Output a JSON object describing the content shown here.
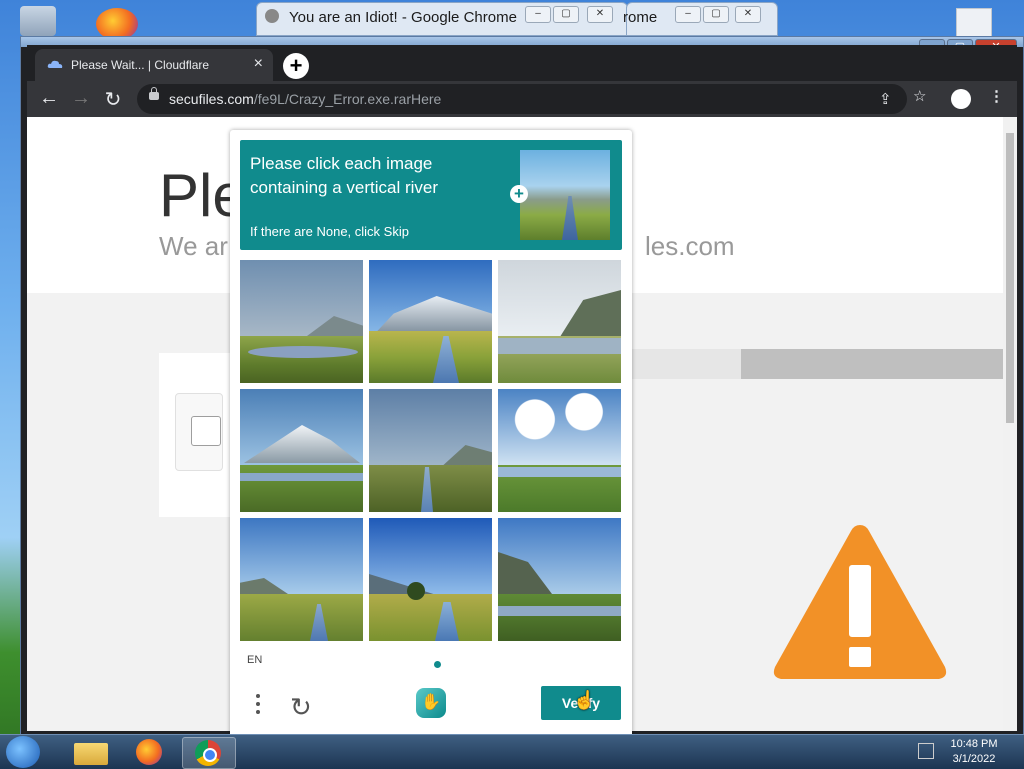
{
  "background_windows": [
    {
      "title": "You are an Idiot! - Google Chrome"
    },
    {
      "title": "rome"
    }
  ],
  "browser": {
    "tab_title": "Please Wait... | Cloudflare",
    "url_host": "secufiles.com",
    "url_path": "/fe9L/Crazy_Error.exe.rarHere"
  },
  "page": {
    "title_fragment": "Ple",
    "subtitle_fragment": "We ar",
    "subtitle_fragment_end": "les.com"
  },
  "captcha": {
    "prompt": "Please click each image containing a vertical river",
    "skip_hint": "If there are None, click Skip",
    "language": "EN",
    "verify_label": "Verify",
    "selected_tile_index": 5,
    "accent_color": "#108b8d"
  },
  "taskbar": {
    "time": "10:48 PM",
    "date": "3/1/2022",
    "apps": [
      "file-explorer-icon",
      "firefox-icon",
      "chrome-icon"
    ]
  }
}
